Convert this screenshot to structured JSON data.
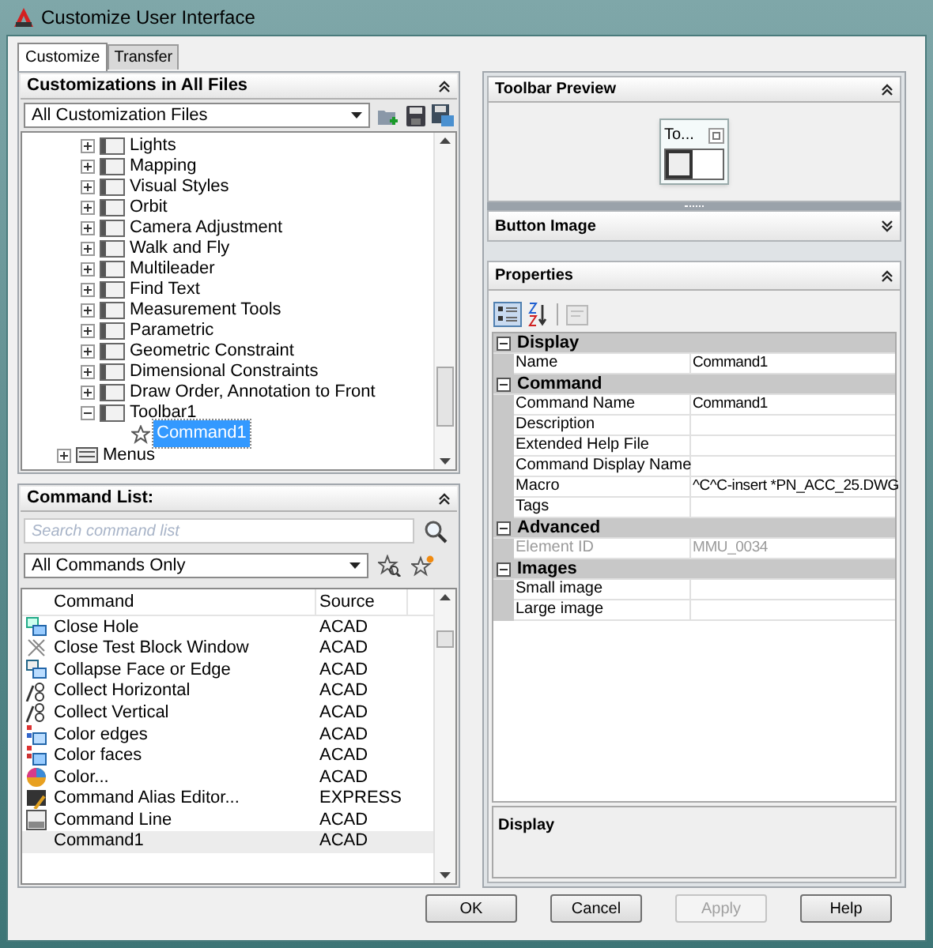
{
  "window": {
    "title": "Customize User Interface"
  },
  "tabs": [
    {
      "label": "Customize",
      "selected": true
    },
    {
      "label": "Transfer",
      "selected": false
    }
  ],
  "customizations_panel": {
    "title": "Customizations in All Files",
    "file_filter": "All Customization Files",
    "tree": {
      "nested_items": [
        {
          "label": "Lights",
          "expanded": false
        },
        {
          "label": "Mapping",
          "expanded": false
        },
        {
          "label": "Visual Styles",
          "expanded": false
        },
        {
          "label": "Orbit",
          "expanded": false
        },
        {
          "label": "Camera Adjustment",
          "expanded": false
        },
        {
          "label": "Walk and Fly",
          "expanded": false
        },
        {
          "label": "Multileader",
          "expanded": false
        },
        {
          "label": "Find Text",
          "expanded": false
        },
        {
          "label": "Measurement Tools",
          "expanded": false
        },
        {
          "label": "Parametric",
          "expanded": false
        },
        {
          "label": "Geometric Constraint",
          "expanded": false
        },
        {
          "label": "Dimensional Constraints",
          "expanded": false
        },
        {
          "label": "Draw Order, Annotation to Front",
          "expanded": false
        },
        {
          "label": "Toolbar1",
          "expanded": true,
          "children": [
            {
              "label": "Command1",
              "selected": true
            }
          ]
        }
      ],
      "top_level_items": [
        {
          "label": "Menus",
          "expanded": false
        }
      ]
    }
  },
  "command_list_panel": {
    "title": "Command List:",
    "search": {
      "placeholder": "Search command list"
    },
    "filter": "All Commands Only",
    "columns": [
      "Command",
      "Source"
    ],
    "rows": [
      {
        "command": "Close Hole",
        "source": "ACAD",
        "selected": false
      },
      {
        "command": "Close Test Block Window",
        "source": "ACAD",
        "selected": false
      },
      {
        "command": "Collapse Face or Edge",
        "source": "ACAD",
        "selected": false
      },
      {
        "command": "Collect Horizontal",
        "source": "ACAD",
        "selected": false
      },
      {
        "command": "Collect Vertical",
        "source": "ACAD",
        "selected": false
      },
      {
        "command": "Color edges",
        "source": "ACAD",
        "selected": false
      },
      {
        "command": "Color faces",
        "source": "ACAD",
        "selected": false
      },
      {
        "command": "Color...",
        "source": "ACAD",
        "selected": false
      },
      {
        "command": "Command Alias Editor...",
        "source": "EXPRESS",
        "selected": false
      },
      {
        "command": "Command Line",
        "source": "ACAD",
        "selected": false
      },
      {
        "command": "Command1",
        "source": "ACAD",
        "selected": true
      }
    ]
  },
  "toolbar_preview": {
    "title": "Toolbar Preview",
    "toolbar_caption": "To..."
  },
  "button_image": {
    "title": "Button Image",
    "expanded": false
  },
  "properties": {
    "title": "Properties",
    "categories": [
      {
        "name": "Display",
        "rows": [
          {
            "label": "Name",
            "value": "Command1",
            "disabled": false
          }
        ]
      },
      {
        "name": "Command",
        "rows": [
          {
            "label": "Command Name",
            "value": "Command1",
            "disabled": false
          },
          {
            "label": "Description",
            "disabled": false
          },
          {
            "label": "Extended Help File",
            "disabled": false
          },
          {
            "label": "Command Display Name",
            "disabled": false
          },
          {
            "label": "Macro",
            "value": "^C^C-insert *PN_ACC_25.DWG",
            "disabled": false
          },
          {
            "label": "Tags",
            "disabled": false
          }
        ]
      },
      {
        "name": "Advanced",
        "rows": [
          {
            "label": "Element ID",
            "value": "MMU_0034",
            "disabled": true
          }
        ]
      },
      {
        "name": "Images",
        "rows": [
          {
            "label": "Small image",
            "disabled": false
          },
          {
            "label": "Large image",
            "disabled": false
          }
        ]
      }
    ],
    "description_title": "Display"
  },
  "buttons": [
    {
      "label": "OK",
      "disabled": false
    },
    {
      "label": "Cancel",
      "disabled": false
    },
    {
      "label": "Apply",
      "disabled": true
    },
    {
      "label": "Help",
      "disabled": false
    }
  ]
}
